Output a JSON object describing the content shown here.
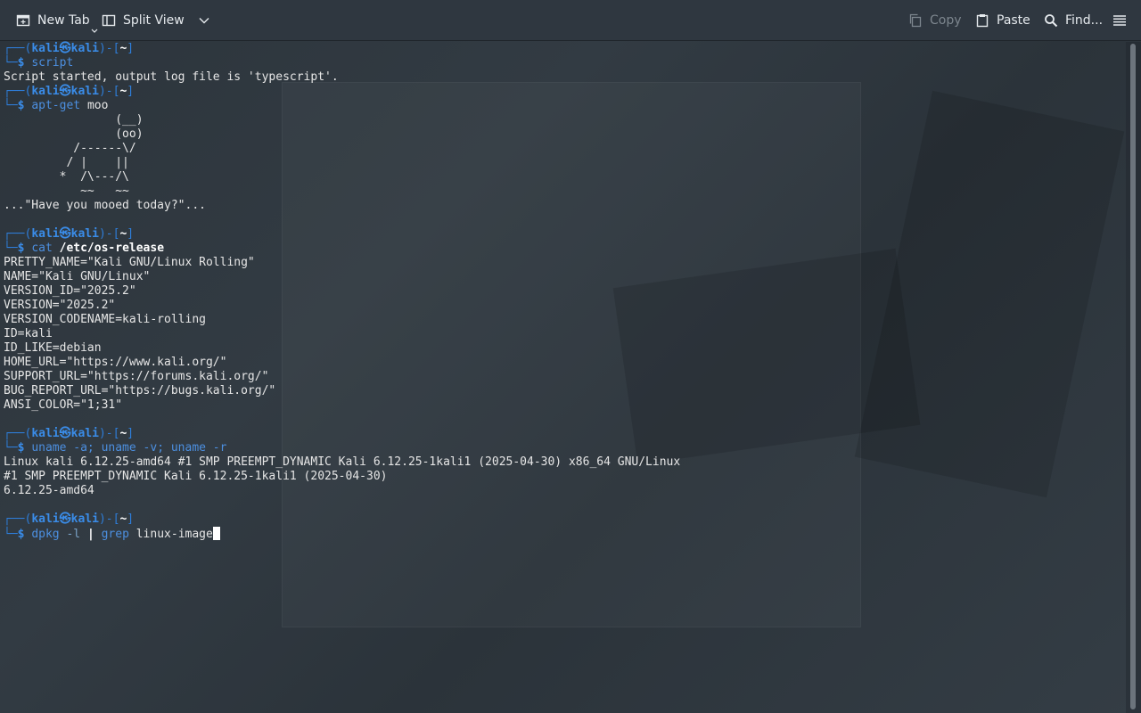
{
  "toolbar": {
    "new_tab": "New Tab",
    "split_view": "Split View",
    "copy": "Copy",
    "paste": "Paste",
    "find": "Find..."
  },
  "prompt": {
    "user": "kali",
    "host": "kali",
    "dir": "~"
  },
  "terminal": {
    "cmd1": "script",
    "out1": "Script started, output log file is 'typescript'.",
    "cmd2_a": "apt-get",
    "cmd2_b": "moo",
    "cow": [
      "                (__)",
      "                (oo)",
      "          /------\\/",
      "         / |    ||",
      "        *  /\\---/\\",
      "           ~~   ~~"
    ],
    "moo": "...\"Have you mooed today?\"...",
    "cmd3_a": "cat",
    "cmd3_b": "/etc/os-release",
    "os_release": [
      "PRETTY_NAME=\"Kali GNU/Linux Rolling\"",
      "NAME=\"Kali GNU/Linux\"",
      "VERSION_ID=\"2025.2\"",
      "VERSION=\"2025.2\"",
      "VERSION_CODENAME=kali-rolling",
      "ID=kali",
      "ID_LIKE=debian",
      "HOME_URL=\"https://www.kali.org/\"",
      "SUPPORT_URL=\"https://forums.kali.org/\"",
      "BUG_REPORT_URL=\"https://bugs.kali.org/\"",
      "ANSI_COLOR=\"1;31\""
    ],
    "cmd4": "uname -a; uname -v; uname -r",
    "uname_out": [
      "Linux kali 6.12.25-amd64 #1 SMP PREEMPT_DYNAMIC Kali 6.12.25-1kali1 (2025-04-30) x86_64 GNU/Linux",
      "#1 SMP PREEMPT_DYNAMIC Kali 6.12.25-1kali1 (2025-04-30)",
      "6.12.25-amd64"
    ],
    "cmd5_a": "dpkg",
    "cmd5_b": " -l ",
    "cmd5_c": "|",
    "cmd5_d": "grep",
    "cmd5_e": "linux-image"
  },
  "colors": {
    "prompt_frame": "#2e7dd8",
    "prompt_user": "#3a8ce8",
    "toolbar_bg": "#2f3740"
  }
}
